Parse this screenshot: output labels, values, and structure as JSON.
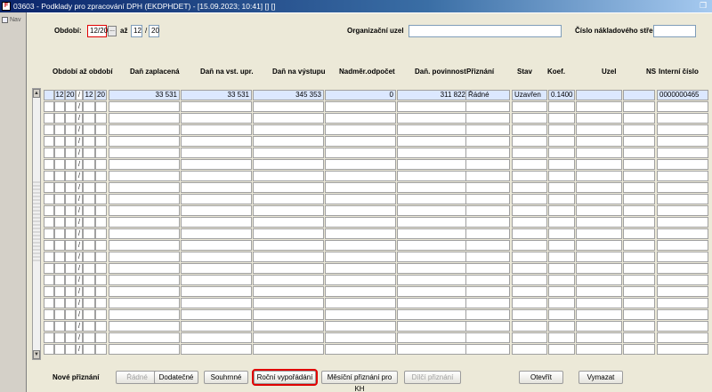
{
  "window": {
    "title": "03603 - Podklady pro zpracování DPH (EKDPHDET) - [15.09.2023; 10:41] [] []"
  },
  "sidepanel": {
    "nav_label": "Nav"
  },
  "filters": {
    "obdobi_label": "Období:",
    "obdobi_from_value": "12/20",
    "lov_button": "...",
    "az_label": "až",
    "obdobi_to_month": "12",
    "obdobi_to_sep": "/",
    "obdobi_to_year": "20",
    "org_uzel_label": "Organizační uzel",
    "org_uzel_value": "",
    "cislo_ns_label": "Číslo nákladového střediska",
    "cislo_ns_value": ""
  },
  "table": {
    "headers": {
      "obdobi_az_obdobi": "Období až období",
      "dan_zaplacena": "Daň zaplacená",
      "dan_vst_upr": "Daň na vst. upr.",
      "dan_vystupu": "Daň na výstupu",
      "nadmer_odpocet": "Nadměr.odpočet",
      "dan_povinnost": "Daň. povinnost",
      "priznani": "Přiznání",
      "stav": "Stav",
      "koef": "Koef.",
      "uzel": "Uzel",
      "ns": "NS",
      "interni_cislo": "Interní číslo"
    },
    "first_row": {
      "from_month": "12",
      "from_year": "20",
      "sep": "/",
      "to_month": "12",
      "to_year": "20",
      "dan_zaplacena": "33 531",
      "dan_vst_upr": "33 531",
      "dan_vystupu": "345 353",
      "nadmer_odpocet": "0",
      "dan_povinnost": "311 822",
      "priznani": "Řádné",
      "stav": "Uzavřen",
      "koef": "0.1400",
      "uzel": "",
      "ns": "",
      "interni_cislo": "0000000465"
    },
    "empty_sep": "/"
  },
  "bottom": {
    "nove_priznani_label": "Nové přiznání",
    "buttons": {
      "radne": "Řádné",
      "dodatecne": "Dodatečné",
      "souhrnne": "Souhrnné",
      "rocni": "Roční vypořádání",
      "mesicni_kh": "Měsíční přiznání pro KH",
      "dilci": "Dílčí přiznání",
      "otevrit": "Otevřít",
      "vymazat": "Vymazat"
    }
  }
}
